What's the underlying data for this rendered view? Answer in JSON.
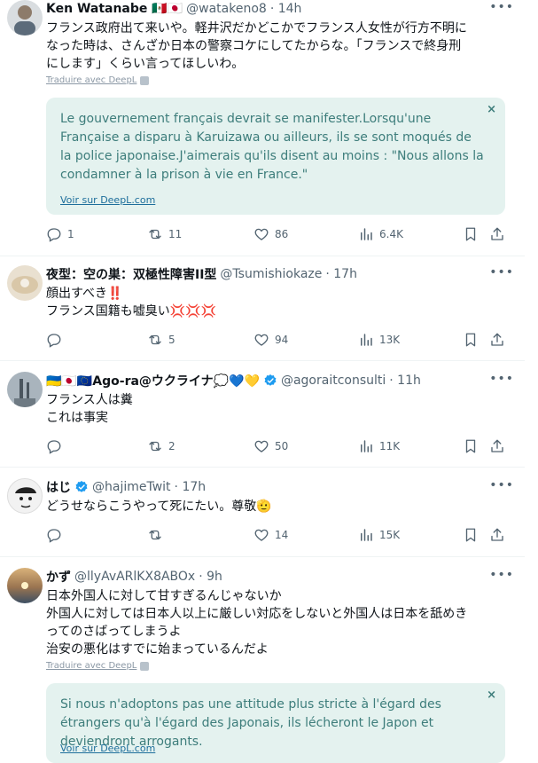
{
  "deepl_label": "Traduire avec DeepL",
  "deepl_link": "Voir sur DeepL.com",
  "close_glyph": "×",
  "tweets": [
    {
      "name": "Ken Watanabe 🇲🇽🇯🇵",
      "handle": "@watakeno8",
      "time": "· 14h",
      "text": "フランス政府出て来いや。軽井沢だかどこかでフランス人女性が行方不明に\nなった時は、さんざか日本の警察コケにしてたからな。「フランスで終身刑\nにします」くらい言ってほしいわ。",
      "translation": "Le gouvernement français devrait se manifester.Lorsqu'une Française a disparu à Karuizawa ou ailleurs, ils se sont moqués de la police japonaise.J'aimerais qu'ils disent au moins : \"Nous allons la condamner à la prison à vie en France.\"",
      "replies": "1",
      "reposts": "11",
      "likes": "86",
      "views": "6.4K"
    },
    {
      "name": "夜型：空の巣：双極性障害II型",
      "handle": "@Tsumishiokaze",
      "time": "· 17h",
      "text": "顔出すべき‼️\nフランス国籍も嘘臭い💢💢💢",
      "replies": "",
      "reposts": "5",
      "likes": "94",
      "views": "13K"
    },
    {
      "name": "🇺🇦🇯🇵🇪🇺Ago-ra@ウクライナ💭💙💛",
      "handle": "@agoraitconsulti",
      "time": "· 11h",
      "text": "フランス人は糞\nこれは事実",
      "replies": "",
      "reposts": "2",
      "likes": "50",
      "views": "11K"
    },
    {
      "name": "はじ",
      "handle": "@hajimeTwit",
      "time": "· 17h",
      "text": "どうせならこうやって死にたい。尊敬🫡",
      "replies": "",
      "reposts": "",
      "likes": "14",
      "views": "15K"
    },
    {
      "name": "かず",
      "handle": "@llyAvARlKX8ABOx",
      "time": "· 9h",
      "text": "日本外国人に対して甘すぎるんじゃないか\n外国人に対しては日本人以上に厳しい対応をしないと外国人は日本を舐めき\nってのさばってしまうよ\n治安の悪化はすでに始まっているんだよ",
      "translation": "Si nous n'adoptons pas une attitude plus stricte à l'égard des étrangers qu'à l'égard des Japonais, ils lécheront le Japon et deviendront arrogants."
    }
  ],
  "colors": {
    "accent": "#1d9bf0",
    "translation_bg": "#e4f2ef",
    "translation_text": "#3d7d7b",
    "muted": "#536471"
  }
}
